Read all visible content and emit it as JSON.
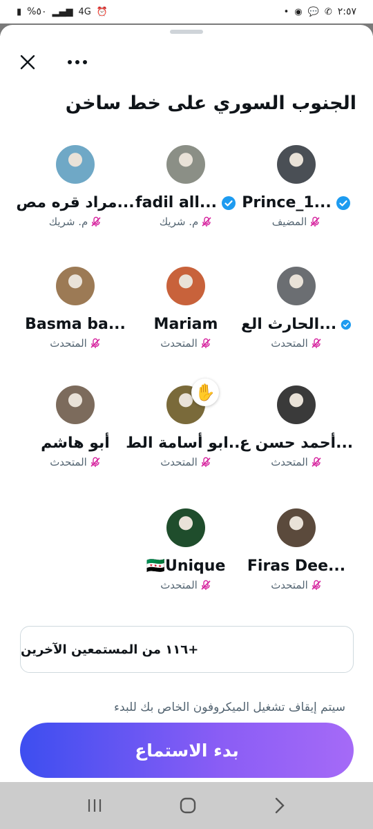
{
  "status_bar": {
    "time": "٢:٥٧",
    "battery": "%٥٠",
    "network": "4G"
  },
  "space": {
    "title": "الجنوب السوري على خط ساخن"
  },
  "speakers": [
    {
      "name": "Prince_1...",
      "role": "المضيف",
      "verified": true,
      "avatar_color": "#4a4f55"
    },
    {
      "name": "fadil all...",
      "role": "م. شريك",
      "verified": true,
      "avatar_color": "#8b8f86"
    },
    {
      "name": "مراد قره مص...",
      "role": "م. شريك",
      "verified": false,
      "avatar_color": "#6fa8c6"
    },
    {
      "name": "الحارث الع...",
      "role": "المتحدث",
      "verified": true,
      "avatar_color": "#6b6e72"
    },
    {
      "name": "Mariam",
      "role": "المتحدث",
      "verified": false,
      "avatar_color": "#c8623b"
    },
    {
      "name": "Basma ba...",
      "role": "المتحدث",
      "verified": false,
      "avatar_color": "#9c7a55"
    },
    {
      "name": "أحمد حسن ع...",
      "role": "المتحدث",
      "verified": false,
      "avatar_color": "#3a3a3a"
    },
    {
      "name": "ابو أسامة الط...",
      "role": "المتحدث",
      "verified": false,
      "avatar_color": "#7a6a3a"
    },
    {
      "name": "أبو هاشم",
      "role": "المتحدث",
      "verified": false,
      "avatar_color": "#7c6b5c"
    },
    {
      "name": "Firas Dee...",
      "role": "المتحدث",
      "verified": false,
      "avatar_color": "#5b4a3c"
    },
    {
      "name": "🇸🇾Unique",
      "role": "المتحدث",
      "verified": false,
      "avatar_color": "#1f4d2c"
    }
  ],
  "listeners": {
    "label": "+١١٦ من المستمعين الآخرين"
  },
  "mic_note": "سيتم إيقاف تشغيل الميكروفون الخاص بك للبدء",
  "start_button": {
    "label": "بدء الاستماع"
  },
  "colors": {
    "accent_start": "#3d4ef0",
    "accent_end": "#a56af7",
    "verified": "#1d9bf0",
    "mic_off": "#d6249f"
  }
}
